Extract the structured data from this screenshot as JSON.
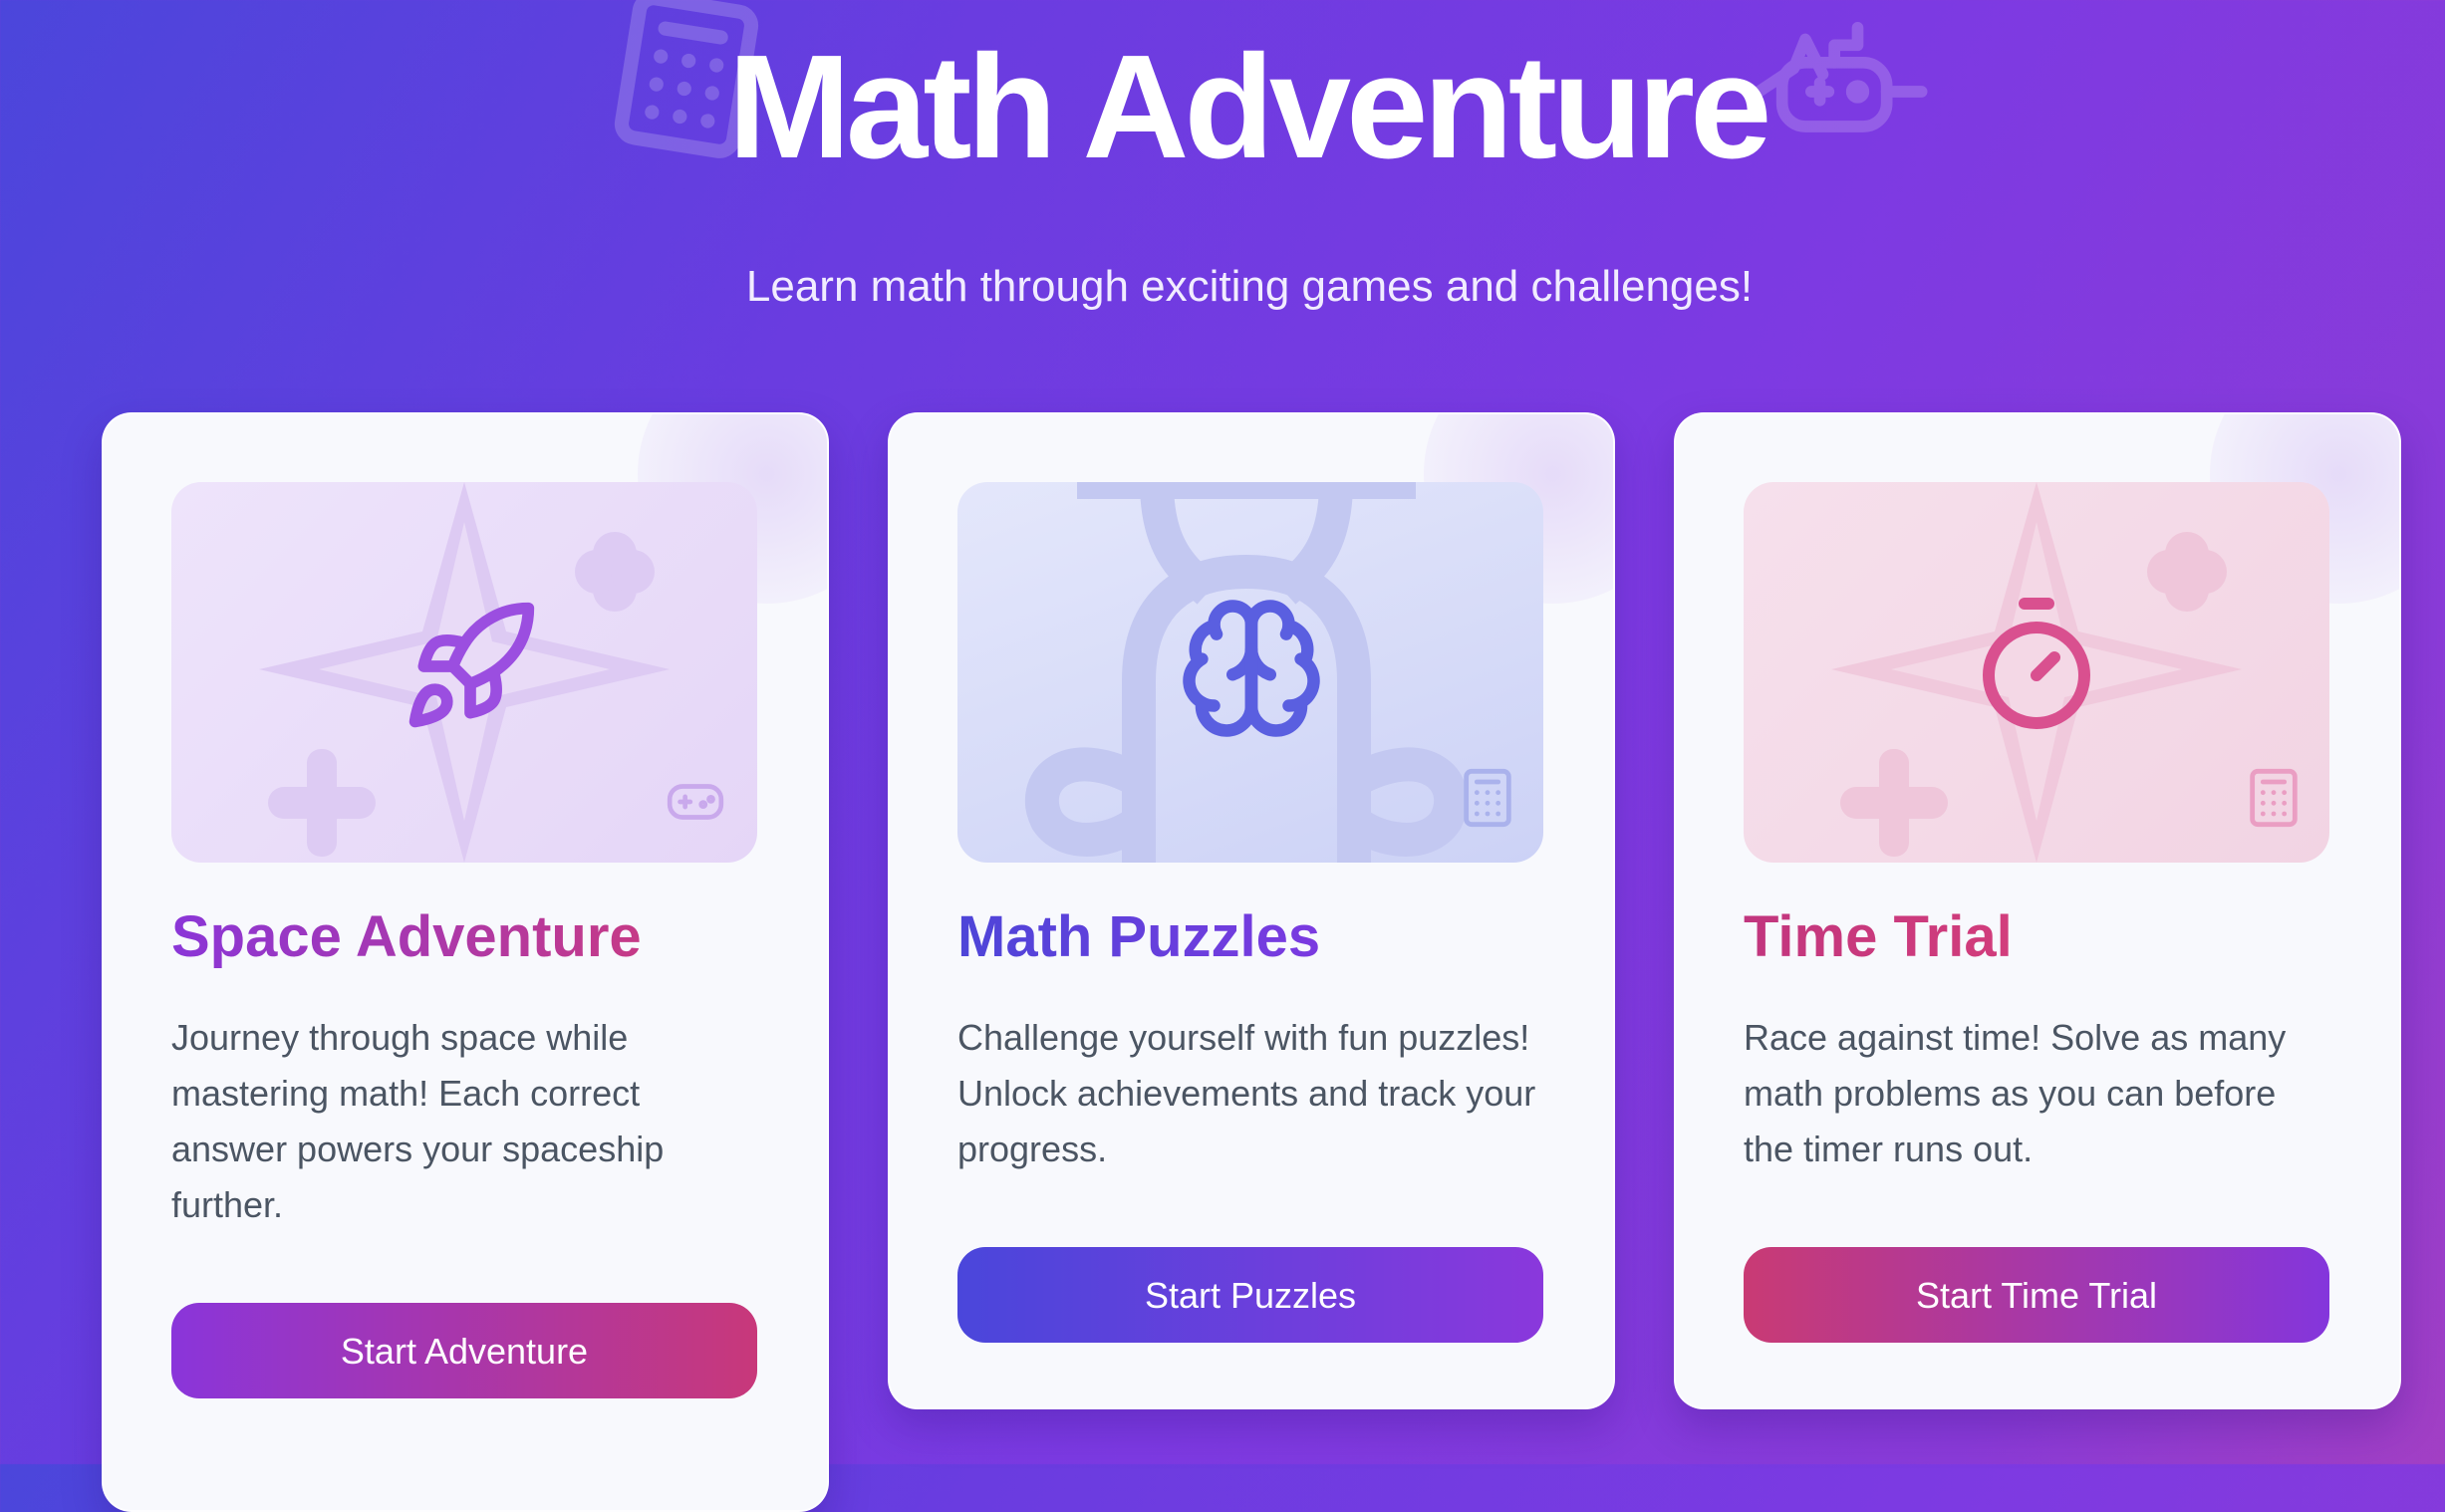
{
  "header": {
    "title": "Math Adventure",
    "subtitle": "Learn math through exciting games and challenges!",
    "decor_icons": [
      "calculator-icon",
      "gamepad-icon"
    ]
  },
  "games": [
    {
      "title": "Space Adventure",
      "description": "Journey through space while mastering math! Each correct answer powers your spaceship further.",
      "button_label": "Start Adventure",
      "icon": "rocket-icon",
      "corner_icon": "gamepad-icon",
      "accent": "#8b3fd9"
    },
    {
      "title": "Math Puzzles",
      "description": "Challenge yourself with fun puzzles! Unlock achievements and track your progress.",
      "button_label": "Start Puzzles",
      "icon": "brain-icon",
      "corner_icon": "calculator-icon",
      "accent": "#5b4ddb"
    },
    {
      "title": "Time Trial",
      "description": "Race against time! Solve as many math problems as you can before the timer runs out.",
      "button_label": "Start Time Trial",
      "icon": "stopwatch-icon",
      "corner_icon": "calculator-icon",
      "accent": "#d94f8f"
    }
  ]
}
